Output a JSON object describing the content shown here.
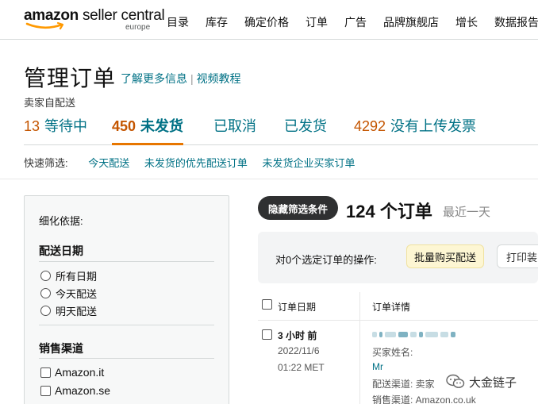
{
  "header": {
    "logo_brand": "amazon",
    "logo_product": "seller central",
    "logo_region": "europe",
    "nav": [
      "目录",
      "库存",
      "确定价格",
      "订单",
      "广告",
      "品牌旗舰店",
      "增长",
      "数据报告"
    ]
  },
  "page": {
    "title": "管理订单",
    "learn_more": "了解更多信息",
    "link_separator": "|",
    "video": "视频教程",
    "subtitle": "卖家自配送"
  },
  "status_tabs": {
    "pending": {
      "count": "13",
      "label": "等待中"
    },
    "unshipped": {
      "count": "450",
      "label": "未发货"
    },
    "cancelled": {
      "label": "已取消"
    },
    "shipped": {
      "label": "已发货"
    },
    "no_invoice": {
      "count": "4292",
      "label": "没有上传发票"
    }
  },
  "quick_filters": {
    "label": "快速筛选:",
    "items": [
      "今天配送",
      "未发货的优先配送订单",
      "未发货企业买家订单"
    ]
  },
  "filters": {
    "refine_label": "细化依据:",
    "delivery_date": {
      "title": "配送日期",
      "options": [
        "所有日期",
        "今天配送",
        "明天配送"
      ]
    },
    "sales_channel": {
      "title": "销售渠道",
      "options": [
        "Amazon.it",
        "Amazon.se"
      ]
    }
  },
  "results": {
    "hide_filters_label": "隐藏筛选条件",
    "order_count": "124 个订单",
    "period": "最近一天"
  },
  "bulk_actions": {
    "label": "对0个选定订单的操作:",
    "buy_shipping": "批量购买配送",
    "print": "打印装"
  },
  "table": {
    "headers": {
      "date": "订单日期",
      "details": "订单详情"
    },
    "rows": [
      {
        "age": "3 小时 前",
        "date": "2022/11/6",
        "time": "01:22 MET",
        "buyer_label": "买家姓名:",
        "buyer_name": "Mr",
        "shipping_channel": "配送渠道: 卖家",
        "sales_channel": "销售渠道: Amazon.co.uk"
      }
    ]
  },
  "watermark": {
    "text": "大金链子"
  },
  "colors": {
    "link": "#007185",
    "count": "#c45500",
    "active_tab_underline": "#e77600",
    "logo_smile": "#ff9900"
  }
}
